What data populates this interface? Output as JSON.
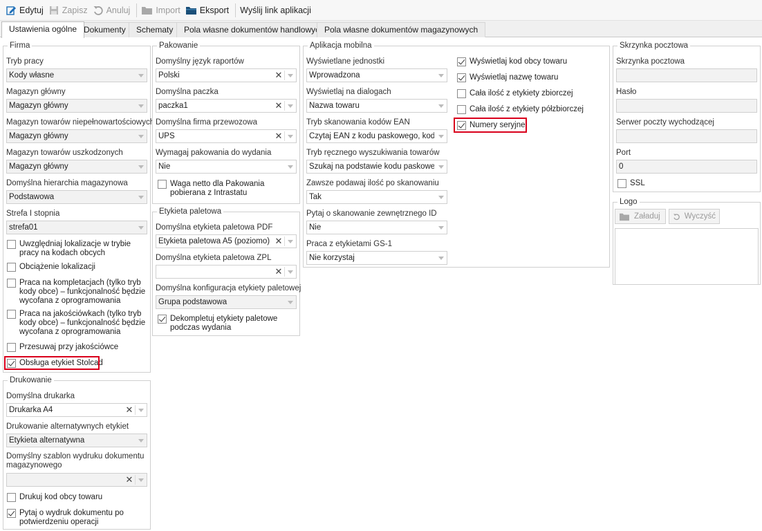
{
  "toolbar": {
    "edit": "Edytuj",
    "save": "Zapisz",
    "cancel": "Anuluj",
    "import": "Import",
    "export": "Eksport",
    "send_link": "Wyślij link aplikacji"
  },
  "tabs": [
    "Ustawienia ogólne",
    "Dokumenty",
    "Schematy",
    "Pola własne dokumentów handlowych",
    "Pola własne dokumentów magazynowych"
  ],
  "firma": {
    "title": "Firma",
    "tryb_pracy_label": "Tryb pracy",
    "tryb_pracy_value": "Kody własne",
    "magazyn_glowny_label": "Magazyn główny",
    "magazyn_glowny_value": "Magazyn główny",
    "magazyn_niepelnowart_label": "Magazyn towarów niepełnowartościowych",
    "magazyn_niepelnowart_value": "Magazyn główny",
    "magazyn_uszkodzonych_label": "Magazyn towarów uszkodzonych",
    "magazyn_uszkodzonych_value": "Magazyn główny",
    "hierarchia_label": "Domyślna hierarchia magazynowa",
    "hierarchia_value": "Podstawowa",
    "strefa_label": "Strefa I stopnia",
    "strefa_value": "strefa01",
    "chk_lokalizacje": "Uwzględniaj lokalizacje w trybie pracy na kodach obcych",
    "chk_obciazenie": "Obciążenie lokalizacji",
    "chk_kompletacje": "Praca na kompletacjach (tylko tryb kody obce) – funkcjonalność będzie wycofana z oprogramowania",
    "chk_jakosciowki": "Praca na jakościówkach (tylko tryb kody obce) – funkcjonalność będzie wycofana z oprogramowania",
    "chk_przesuwaj": "Przesuwaj przy jakościówce",
    "chk_stolcad": "Obsługa etykiet Stolcad"
  },
  "drukowanie": {
    "title": "Drukowanie",
    "drukarka_label": "Domyślna drukarka",
    "drukarka_value": "Drukarka A4",
    "alt_label": "Drukowanie alternatywnych etykiet",
    "alt_value": "Etykieta alternatywna",
    "szablon_label_1": "Domyślny szablon wydruku dokumentu",
    "szablon_label_2": "magazynowego",
    "szablon_value": "",
    "chk_kod_obcy": "Drukuj kod obcy towaru",
    "chk_pytaj": "Pytaj o wydruk dokumentu po potwierdzeniu operacji"
  },
  "pakowanie": {
    "title": "Pakowanie",
    "jezyk_label": "Domyślny język raportów",
    "jezyk_value": "Polski",
    "paczka_label": "Domyślna paczka",
    "paczka_value": "paczka1",
    "firma_label": "Domyślna firma przewozowa",
    "firma_value": "UPS",
    "wymagaj_label": "Wymagaj pakowania do wydania",
    "wymagaj_value": "Nie",
    "chk_waga": "Waga netto dla Pakowania pobierana z Intrastatu"
  },
  "etykieta": {
    "title": "Etykieta paletowa",
    "pdf_label": "Domyślna etykieta paletowa PDF",
    "pdf_value": "Etykieta paletowa A5 (poziomo)",
    "zpl_label": "Domyślna etykieta paletowa ZPL",
    "zpl_value": "",
    "konfig_label": "Domyślna konfiguracja etykiety paletowej",
    "konfig_value": "Grupa podstawowa",
    "chk_dekompletuj": "Dekompletuj etykiety paletowe podczas wydania"
  },
  "aplikacja": {
    "title": "Aplikacja mobilna",
    "jednostki_label": "Wyświetlane jednostki",
    "jednostki_value": "Wprowadzona",
    "dialogi_label": "Wyświetlaj na dialogach",
    "dialogi_value": "Nazwa towaru",
    "ean_label": "Tryb skanowania kodów EAN",
    "ean_value": "Czytaj EAN z kodu paskowego, kod...",
    "reczny_label": "Tryb ręcznego wyszukiwania towarów",
    "reczny_value": "Szukaj na podstawie kodu paskowe...",
    "ilosc_label": "Zawsze podawaj ilość po skanowaniu",
    "ilosc_value": "Tak",
    "zewn_label": "Pytaj o skanowanie zewnętrznego ID",
    "zewn_value": "Nie",
    "gs1_label": "Praca z etykietami GS-1",
    "gs1_value": "Nie korzystaj",
    "chk_kod_obcy": "Wyświetlaj kod obcy towaru",
    "chk_nazwa": "Wyświetlaj nazwę towaru",
    "chk_zbiorcza": "Cała ilość z etykiety zbiorczej",
    "chk_polzbiorcza": "Cała ilość z etykiety półzbiorczej",
    "chk_seryjne": "Numery seryjne"
  },
  "skrzynka": {
    "title": "Skrzynka pocztowa",
    "skrzynka_label": "Skrzynka pocztowa",
    "skrzynka_value": "",
    "haslo_label": "Hasło",
    "haslo_value": "",
    "serwer_label": "Serwer poczty wychodzącej",
    "serwer_value": "",
    "port_label": "Port",
    "port_value": "0",
    "chk_ssl": "SSL"
  },
  "logo": {
    "title": "Logo",
    "load": "Załaduj",
    "clear": "Wyczyść"
  }
}
